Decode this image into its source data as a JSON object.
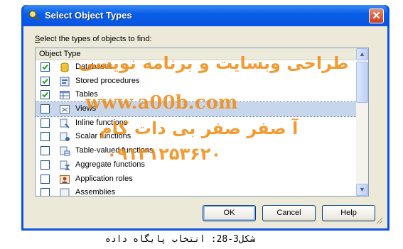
{
  "dialog": {
    "title": "Select Object Types",
    "close_glyph": "✕",
    "prompt_prefix": "S",
    "prompt_rest": "elect the types of objects to find:",
    "column_header": "Object Type",
    "items": [
      {
        "label": "Databases",
        "checked": true,
        "icon": "database-icon"
      },
      {
        "label": "Stored procedures",
        "checked": true,
        "icon": "stored-procedure-icon"
      },
      {
        "label": "Tables",
        "checked": true,
        "icon": "table-icon"
      },
      {
        "label": "Views",
        "checked": false,
        "icon": "view-icon",
        "selected": true
      },
      {
        "label": "Inline functions",
        "checked": false,
        "icon": "inline-function-icon"
      },
      {
        "label": "Scalar functions",
        "checked": false,
        "icon": "scalar-function-icon"
      },
      {
        "label": "Table-valued functions",
        "checked": false,
        "icon": "table-valued-function-icon"
      },
      {
        "label": "Aggregate functions",
        "checked": false,
        "icon": "aggregate-function-icon"
      },
      {
        "label": "Application roles",
        "checked": false,
        "icon": "application-role-icon"
      },
      {
        "label": "Assemblies",
        "checked": false,
        "icon": "assembly-icon"
      }
    ],
    "buttons": {
      "ok": "OK",
      "cancel": "Cancel",
      "help": "Help"
    },
    "scroll_up": "▲",
    "scroll_down": "▼"
  },
  "watermark": {
    "line1": "طراحی وبسایت و برنامه نویسی",
    "line2": "www.a00b.com",
    "line3": "آ صفر صفر بی دات کام",
    "line4": "۰۹۱۳۱۲۵۳۶۲۰"
  },
  "caption": "شکل3-28: انتخاب پایگاه داده",
  "colors": {
    "titlebar": "#0a54e3",
    "selection": "#c8d6ec",
    "watermark": "#f08a10",
    "check": "#21a121"
  }
}
